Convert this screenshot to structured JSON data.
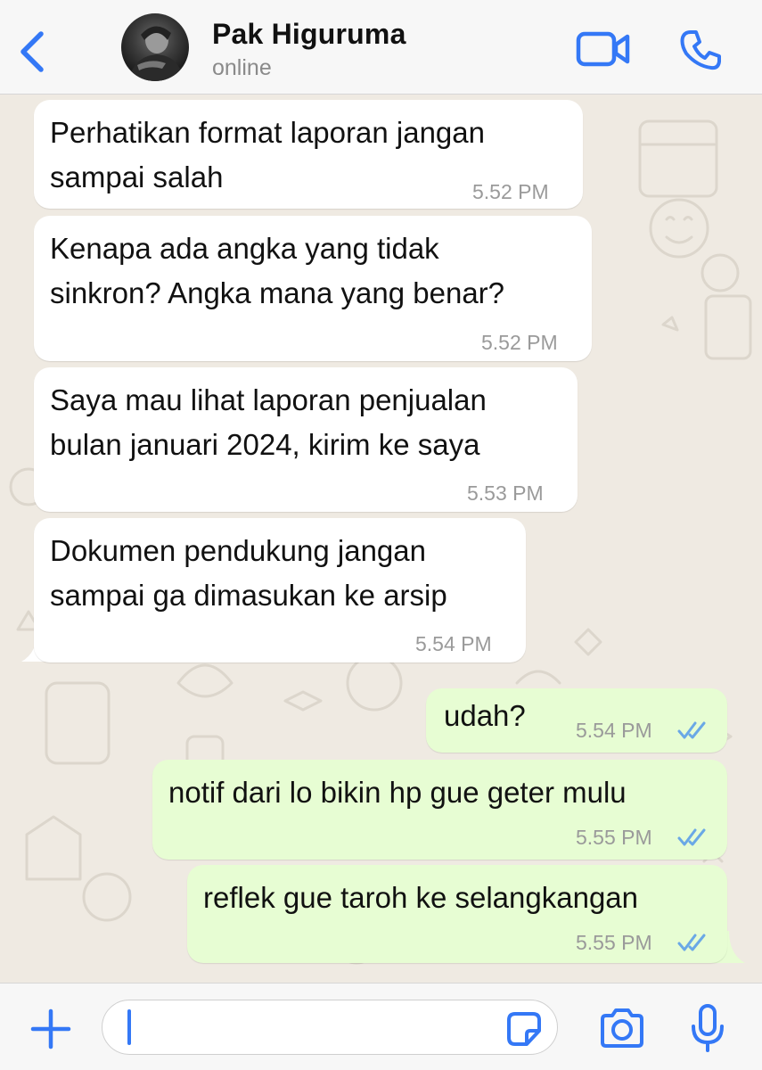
{
  "header": {
    "back_icon": "chevron-left-icon",
    "contact_name": "Pak Higuruma",
    "contact_status": "online",
    "video_icon": "video-call-icon",
    "call_icon": "phone-icon"
  },
  "messages": [
    {
      "direction": "incoming",
      "text": "Perhatikan format laporan jangan\nsampai salah",
      "time": "5.52 PM"
    },
    {
      "direction": "incoming",
      "text": "Kenapa ada angka yang tidak\nsinkron? Angka mana yang benar?",
      "time": "5.52 PM"
    },
    {
      "direction": "incoming",
      "text": "Saya mau lihat laporan penjualan\nbulan januari 2024, kirim ke saya",
      "time": "5.53 PM"
    },
    {
      "direction": "incoming",
      "text": "Dokumen pendukung jangan\nsampai ga dimasukan ke arsip",
      "time": "5.54 PM"
    },
    {
      "direction": "outgoing",
      "text": "udah?",
      "time": "5.54 PM",
      "status": "read"
    },
    {
      "direction": "outgoing",
      "text": "notif dari lo bikin hp gue geter mulu",
      "time": "5.55 PM",
      "status": "read"
    },
    {
      "direction": "outgoing",
      "text": "reflek gue taroh ke selangkangan",
      "time": "5.55 PM",
      "status": "read"
    }
  ],
  "input_bar": {
    "message_value": "",
    "attach_icon": "plus-icon",
    "sticker_icon": "sticker-icon",
    "camera_icon": "camera-icon",
    "mic_icon": "microphone-icon"
  },
  "colors": {
    "accent": "#3478f6",
    "incoming_bubble": "#ffffff",
    "outgoing_bubble": "#e7fdd3",
    "read_ticks": "#6aa8e6",
    "chat_background": "#efeae2"
  }
}
